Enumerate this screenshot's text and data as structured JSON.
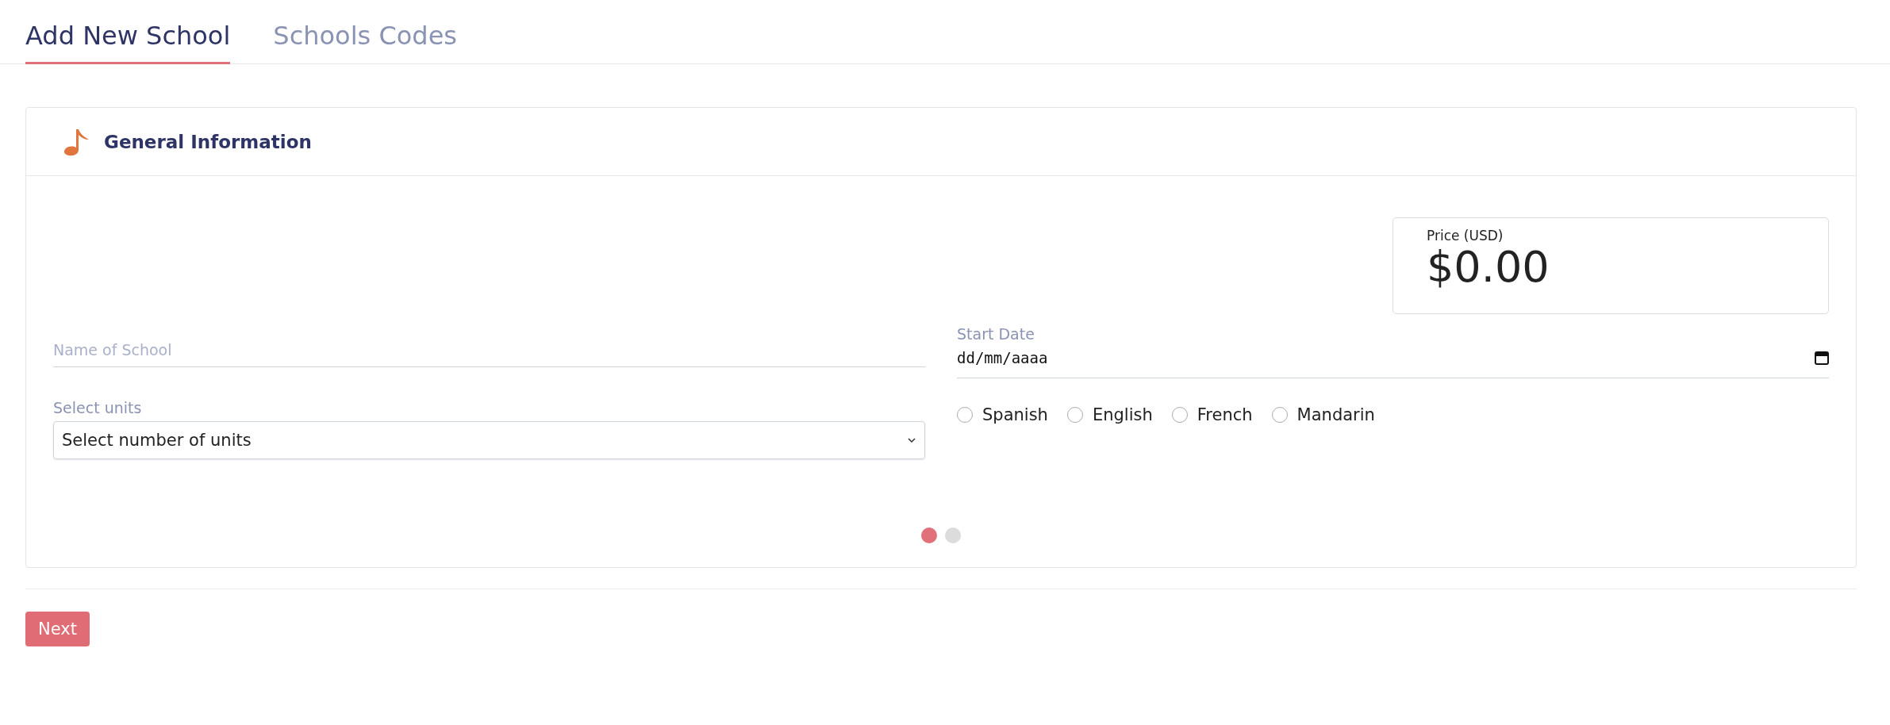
{
  "tabs": [
    {
      "label": "Add New School",
      "selected": true
    },
    {
      "label": "Schools Codes",
      "selected": false
    }
  ],
  "card": {
    "title": "General Information",
    "price": {
      "label": "Price (USD)",
      "value": "$0.00"
    },
    "name_field": {
      "placeholder": "Name of School"
    },
    "start_date": {
      "label": "Start Date",
      "value": "dd/mm/aaaa"
    },
    "units": {
      "label": "Select units",
      "value": "Select number of units"
    },
    "languages": [
      {
        "label": "Spanish",
        "selected": false
      },
      {
        "label": "English",
        "selected": false
      },
      {
        "label": "French",
        "selected": false
      },
      {
        "label": "Mandarin",
        "selected": false
      }
    ],
    "steps": [
      {
        "selected": true
      },
      {
        "selected": false
      }
    ]
  },
  "buttons": {
    "next": "Next"
  }
}
